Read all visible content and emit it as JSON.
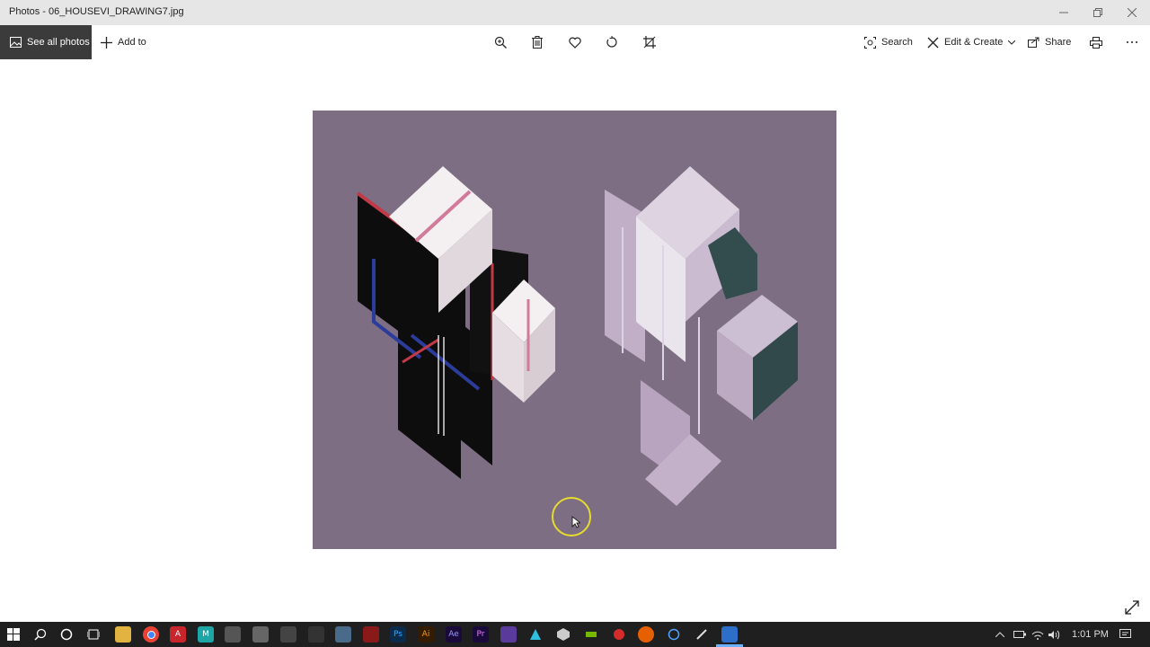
{
  "window": {
    "title": "Photos - 06_HOUSEVI_DRAWING7.jpg",
    "controls": [
      "minimize-icon",
      "restore-icon",
      "close-icon"
    ]
  },
  "toolbar": {
    "see_all_label": "See all photos",
    "add_to_label": "Add to",
    "center_icons": [
      "zoom-icon",
      "delete-icon",
      "heart-icon",
      "rotate-icon",
      "crop-icon"
    ],
    "search_label": "Search",
    "edit_create_label": "Edit & Create",
    "share_label": "Share",
    "right_icons": [
      "print-icon",
      "more-icon"
    ]
  },
  "photo": {
    "background": "#7d6e83",
    "accent_red": "#c23a48",
    "accent_blue": "#2b3c9a"
  },
  "taskbar": {
    "apps": [
      "start-icon",
      "search-icon",
      "cortana-icon",
      "task-view-icon",
      "file-explorer-icon",
      "chrome-icon",
      "acrobat-icon",
      "app-icon",
      "app-icon",
      "app-icon",
      "app-icon",
      "app-icon",
      "app-icon",
      "acrobat-icon",
      "photoshop-icon",
      "illustrator-icon",
      "after-effects-icon",
      "premiere-icon",
      "app-icon",
      "app-icon",
      "app-icon",
      "app-icon",
      "record-icon",
      "firefox-icon",
      "app-icon",
      "photos-icon"
    ],
    "clock": "1:01 PM",
    "tray_icons": [
      "chevron-up-icon",
      "battery-icon",
      "wifi-icon",
      "volume-icon",
      "notification-icon"
    ]
  }
}
